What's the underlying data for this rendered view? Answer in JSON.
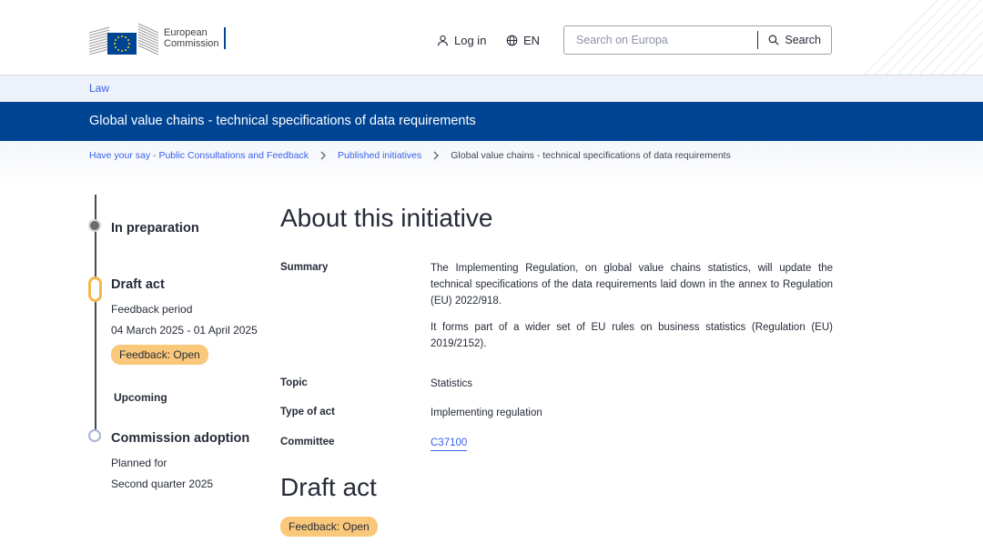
{
  "header": {
    "logo_line1": "European",
    "logo_line2": "Commission",
    "login_label": "Log in",
    "language_label": "EN",
    "search_placeholder": "Search on Europa",
    "search_button_label": "Search"
  },
  "lawbar": {
    "label": "Law"
  },
  "page_title": "Global value chains - technical specifications of data requirements",
  "breadcrumb": [
    "Have your say - Public Consultations and Feedback",
    "Published initiatives",
    "Global value chains - technical specifications of data requirements"
  ],
  "timeline": {
    "step1": {
      "title": "In preparation"
    },
    "step2": {
      "title": "Draft act",
      "subtitle": "Feedback period",
      "dates": "04 March 2025 - 01 April 2025",
      "badge": "Feedback: Open"
    },
    "upcoming_label": "Upcoming",
    "step3": {
      "title": "Commission adoption",
      "subtitle": "Planned for",
      "date": "Second quarter 2025"
    }
  },
  "about": {
    "heading": "About this initiative",
    "summary_label": "Summary",
    "summary_p1": "The Implementing Regulation, on global value chains statistics, will update the technical specifications of the data requirements laid down in the annex to Regulation (EU) 2022/918.",
    "summary_p2": "It forms part of a wider set of EU rules on business statistics (Regulation (EU) 2019/2152).",
    "topic_label": "Topic",
    "topic_value": "Statistics",
    "type_label": "Type of act",
    "type_value": "Implementing regulation",
    "committee_label": "Committee",
    "committee_value": "C37100"
  },
  "draft_section": {
    "heading": "Draft act",
    "badge": "Feedback: Open"
  },
  "colors": {
    "brand_blue": "#004494",
    "link_blue": "#3860ed",
    "badge_yellow": "#f9c87a",
    "timeline_active": "#f5b850"
  }
}
